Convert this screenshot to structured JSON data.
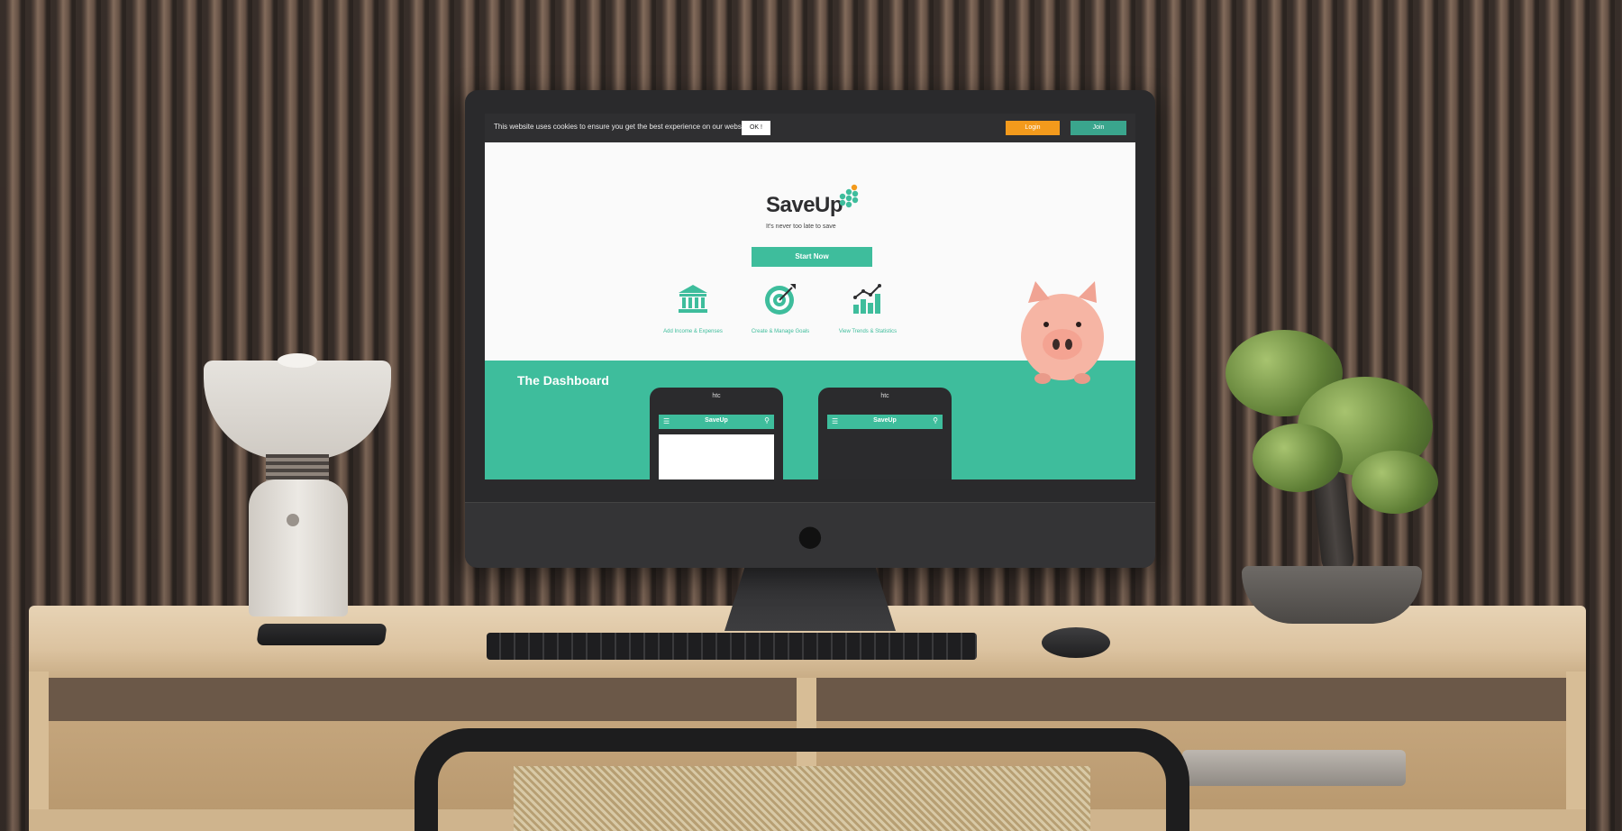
{
  "cookie_bar": {
    "message": "This website uses cookies to ensure you get the best experience on our website.",
    "ok_label": "OK !",
    "login_label": "Login",
    "join_label": "Join"
  },
  "hero": {
    "logo": "SaveUp",
    "tagline": "It's never too late to save",
    "cta_label": "Start Now"
  },
  "features": [
    {
      "label": "Add Income & Expenses",
      "icon": "bank-icon"
    },
    {
      "label": "Create & Manage Goals",
      "icon": "target-icon"
    },
    {
      "label": "View Trends & Statistics",
      "icon": "bar-chart-icon"
    }
  ],
  "dashboard": {
    "title": "The Dashboard",
    "phones": [
      {
        "brand": "htc",
        "app_title": "SaveUp"
      },
      {
        "brand": "htc",
        "app_title": "SaveUp"
      }
    ]
  },
  "colors": {
    "accent": "#3ebd9c",
    "login": "#f39a1c",
    "join": "#3aa58d"
  }
}
